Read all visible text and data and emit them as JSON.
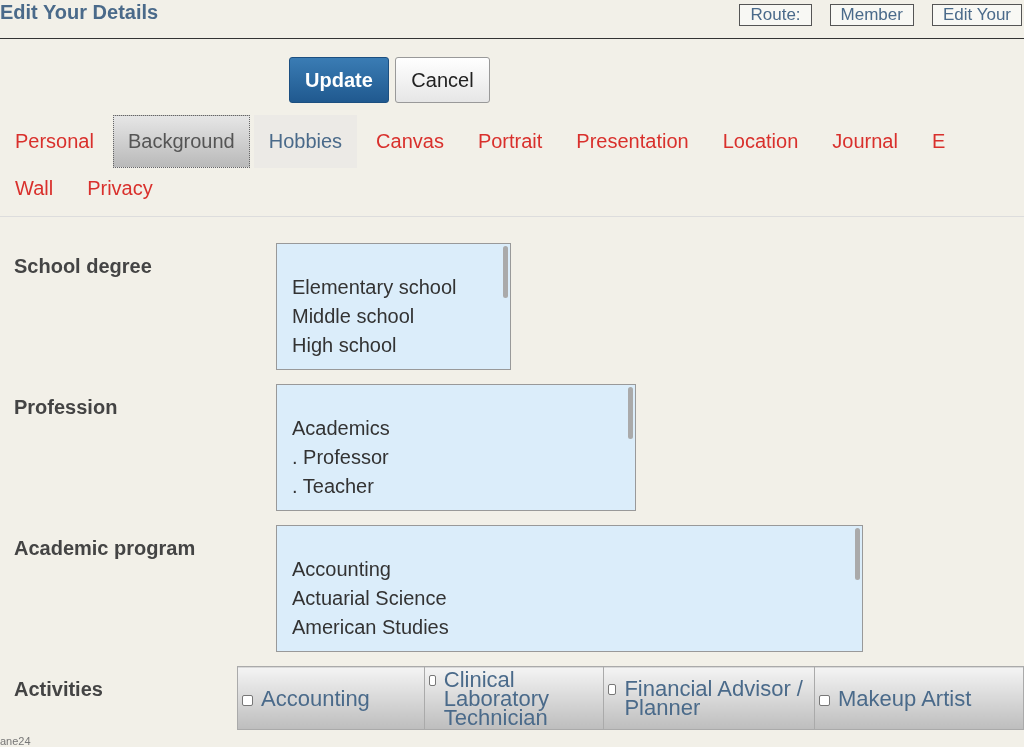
{
  "header": {
    "title": "Edit Your Details",
    "breadcrumbs": [
      "Route:",
      "Member",
      "Edit Your"
    ]
  },
  "buttons": [
    {
      "label": "Update",
      "kind": "primary"
    },
    {
      "label": "Cancel",
      "kind": "default"
    }
  ],
  "tabs": [
    {
      "label": "Personal",
      "selected": false,
      "hovered": false
    },
    {
      "label": "Background",
      "selected": true,
      "hovered": false
    },
    {
      "label": "Hobbies",
      "selected": false,
      "hovered": true
    },
    {
      "label": "Canvas",
      "selected": false,
      "hovered": false
    },
    {
      "label": "Portrait",
      "selected": false,
      "hovered": false
    },
    {
      "label": "Presentation",
      "selected": false,
      "hovered": false
    },
    {
      "label": "Location",
      "selected": false,
      "hovered": false
    },
    {
      "label": "Journal",
      "selected": false,
      "hovered": false
    },
    {
      "label": "E",
      "selected": false,
      "hovered": false
    },
    {
      "label": "Wall",
      "selected": false,
      "hovered": false
    },
    {
      "label": "Privacy",
      "selected": false,
      "hovered": false
    }
  ],
  "fields": [
    {
      "label": "School degree",
      "options": [
        "Elementary school",
        "Middle school",
        "High school"
      ]
    },
    {
      "label": "Profession",
      "options": [
        "Academics",
        ". Professor",
        ". Teacher"
      ]
    },
    {
      "label": "Academic program",
      "options": [
        "Accounting",
        "Actuarial Science",
        "American Studies"
      ]
    }
  ],
  "activities": {
    "label": "Activities",
    "items": [
      {
        "label": "Accounting",
        "checked": false
      },
      {
        "label": "Clinical Laboratory Technician",
        "checked": false
      },
      {
        "label": "Financial Advisor / Planner",
        "checked": false
      },
      {
        "label": "Makeup Artist",
        "checked": false
      }
    ]
  },
  "status": "ane24"
}
